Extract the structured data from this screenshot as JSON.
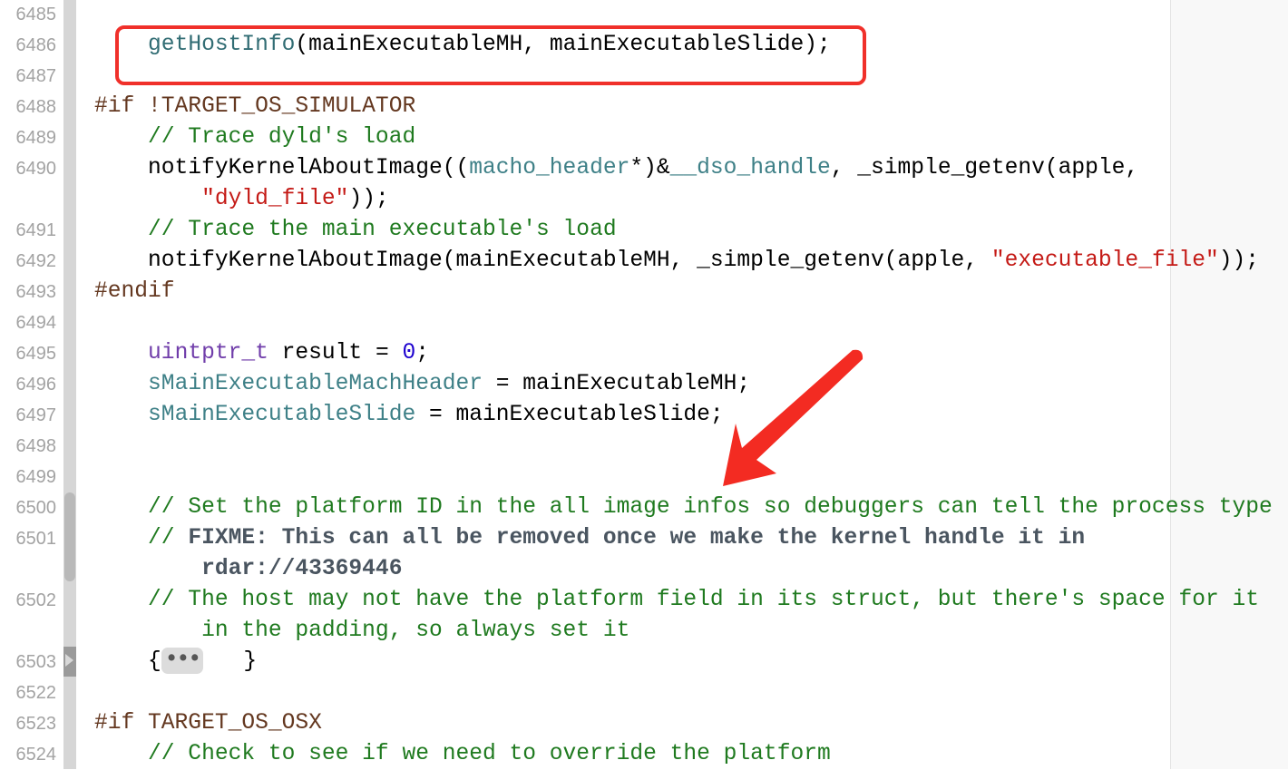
{
  "editor": {
    "colors": {
      "comment": "#1f7a1f",
      "preprocessor": "#643820",
      "function": "#326d74",
      "string": "#c41a16",
      "number": "#1c00cf",
      "type": "#703daa",
      "annotation": "#f0302a"
    },
    "fold_icon": "disclosure-triangle-icon",
    "lines": [
      {
        "num": "6485",
        "rows": [
          []
        ]
      },
      {
        "num": "6486",
        "rows": [
          [
            [
              "    ",
              ""
            ],
            [
              "getHostInfo",
              "fn"
            ],
            [
              "(mainExecutableMH, mainExecutableSlide);",
              ""
            ]
          ]
        ]
      },
      {
        "num": "6487",
        "rows": [
          []
        ]
      },
      {
        "num": "6488",
        "rows": [
          [
            [
              "#if !TARGET_OS_SIMULATOR",
              "pp"
            ]
          ]
        ]
      },
      {
        "num": "6489",
        "rows": [
          [
            [
              "    // Trace dyld's load",
              "cm"
            ]
          ]
        ]
      },
      {
        "num": "6490",
        "rows": [
          [
            [
              "    notifyKernelAboutImage((",
              ""
            ],
            [
              "macho_header",
              "pv"
            ],
            [
              "*)&",
              ""
            ],
            [
              "__dso_handle",
              "pv"
            ],
            [
              ", _simple_getenv(apple,",
              ""
            ]
          ],
          [
            [
              "        ",
              ""
            ],
            [
              "\"dyld_file\"",
              "st"
            ],
            [
              "));",
              ""
            ]
          ]
        ]
      },
      {
        "num": "6491",
        "rows": [
          [
            [
              "    // Trace the main executable's load",
              "cm"
            ]
          ]
        ]
      },
      {
        "num": "6492",
        "rows": [
          [
            [
              "    notifyKernelAboutImage(mainExecutableMH, _simple_getenv(apple, ",
              ""
            ],
            [
              "\"executable_file\"",
              "st"
            ],
            [
              "));",
              ""
            ]
          ]
        ]
      },
      {
        "num": "6493",
        "rows": [
          [
            [
              "#endif",
              "pp"
            ]
          ]
        ]
      },
      {
        "num": "6494",
        "rows": [
          []
        ]
      },
      {
        "num": "6495",
        "rows": [
          [
            [
              "    ",
              ""
            ],
            [
              "uintptr_t",
              "ty"
            ],
            [
              " result = ",
              ""
            ],
            [
              "0",
              "nm"
            ],
            [
              ";",
              ""
            ]
          ]
        ]
      },
      {
        "num": "6496",
        "rows": [
          [
            [
              "    ",
              ""
            ],
            [
              "sMainExecutableMachHeader",
              "pv"
            ],
            [
              " = mainExecutableMH;",
              ""
            ]
          ]
        ]
      },
      {
        "num": "6497",
        "rows": [
          [
            [
              "    ",
              ""
            ],
            [
              "sMainExecutableSlide",
              "pv"
            ],
            [
              " = mainExecutableSlide;",
              ""
            ]
          ]
        ]
      },
      {
        "num": "6498",
        "rows": [
          []
        ]
      },
      {
        "num": "6499",
        "rows": [
          []
        ]
      },
      {
        "num": "6500",
        "rows": [
          [
            [
              "    // Set the platform ID in the all image infos so debuggers can tell the process type",
              "cm"
            ]
          ]
        ]
      },
      {
        "num": "6501",
        "rows": [
          [
            [
              "    // ",
              "cm"
            ],
            [
              "FIXME: This can all be removed once we make the kernel handle it in",
              "mk"
            ]
          ],
          [
            [
              "        rdar://43369446",
              "mk"
            ]
          ]
        ]
      },
      {
        "num": "6502",
        "rows": [
          [
            [
              "    // The host may not have the platform field in its struct, but there's space for it",
              "cm"
            ]
          ],
          [
            [
              "        in the padding, so always set it",
              "cm"
            ]
          ]
        ]
      },
      {
        "num": "6503",
        "rows": [
          [
            [
              "    {",
              ""
            ],
            [
              "•••",
              "chip"
            ],
            [
              "   }",
              ""
            ]
          ]
        ]
      },
      {
        "num": "6522",
        "rows": [
          []
        ]
      },
      {
        "num": "6523",
        "rows": [
          [
            [
              "#if TARGET_OS_OSX",
              "pp"
            ]
          ]
        ]
      },
      {
        "num": "6524",
        "rows": [
          [
            [
              "    // Check to see if we need to override the platform",
              "cm"
            ]
          ]
        ]
      }
    ]
  }
}
